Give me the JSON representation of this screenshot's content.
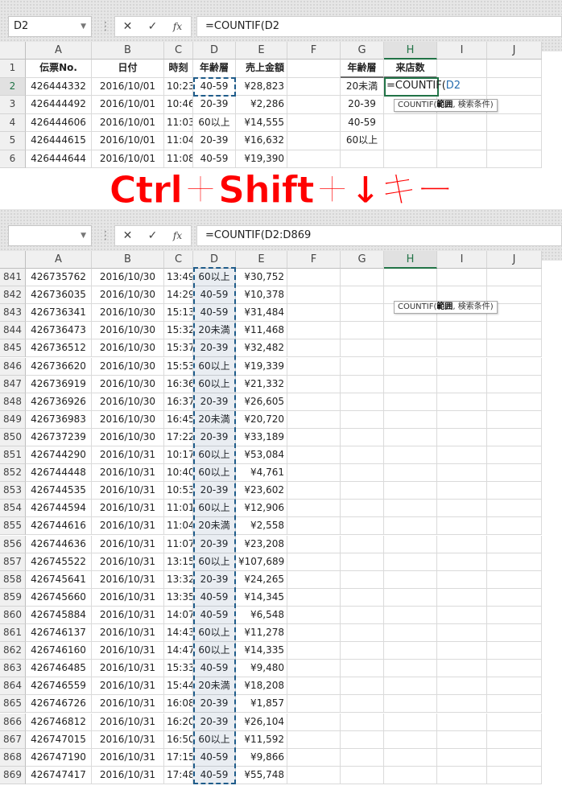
{
  "top": {
    "name_box": "D2",
    "formula": "=COUNTIF(D2",
    "columns": [
      "A",
      "B",
      "C",
      "D",
      "E",
      "F",
      "G",
      "H",
      "I",
      "J"
    ],
    "rows": [
      {
        "n": "1",
        "a": "伝票No.",
        "b": "日付",
        "c": "時刻",
        "d": "年齢層",
        "e": "売上金額",
        "g": "年齢層",
        "h": "来店数"
      },
      {
        "n": "2",
        "a": "426444332",
        "b": "2016/10/01",
        "c": "10:23",
        "d": "40-59",
        "e": "¥28,823",
        "g": "20未満"
      },
      {
        "n": "3",
        "a": "426444492",
        "b": "2016/10/01",
        "c": "10:46",
        "d": "20-39",
        "e": "¥2,286",
        "g": "20-39"
      },
      {
        "n": "4",
        "a": "426444606",
        "b": "2016/10/01",
        "c": "11:03",
        "d": "60以上",
        "e": "¥14,555",
        "g": "40-59"
      },
      {
        "n": "5",
        "a": "426444615",
        "b": "2016/10/01",
        "c": "11:04",
        "d": "20-39",
        "e": "¥16,632",
        "g": "60以上"
      },
      {
        "n": "6",
        "a": "426444644",
        "b": "2016/10/01",
        "c": "11:08",
        "d": "40-59",
        "e": "¥19,390",
        "g": ""
      }
    ],
    "editing_cell": {
      "prefix": "=COUNTIF(",
      "ref": "D2"
    },
    "tooltip": {
      "fn": "COUNTIF(",
      "arg1": "範囲",
      "rest": ", 検索条件)"
    }
  },
  "key_hint": "Ctrl＋Shift＋↓キー",
  "bottom": {
    "name_box": "",
    "formula": "=COUNTIF(D2:D869",
    "columns": [
      "A",
      "B",
      "C",
      "D",
      "E",
      "F",
      "G",
      "H",
      "I",
      "J"
    ],
    "tooltip": {
      "fn": "COUNTIF(",
      "arg1": "範囲",
      "rest": ", 検索条件)"
    },
    "rows": [
      {
        "n": "841",
        "a": "426735762",
        "b": "2016/10/30",
        "c": "13:49",
        "d": "60以上",
        "e": "¥30,752"
      },
      {
        "n": "842",
        "a": "426736035",
        "b": "2016/10/30",
        "c": "14:29",
        "d": "40-59",
        "e": "¥10,378"
      },
      {
        "n": "843",
        "a": "426736341",
        "b": "2016/10/30",
        "c": "15:13",
        "d": "40-59",
        "e": "¥31,484"
      },
      {
        "n": "844",
        "a": "426736473",
        "b": "2016/10/30",
        "c": "15:32",
        "d": "20未満",
        "e": "¥11,468"
      },
      {
        "n": "845",
        "a": "426736512",
        "b": "2016/10/30",
        "c": "15:37",
        "d": "20-39",
        "e": "¥32,482"
      },
      {
        "n": "846",
        "a": "426736620",
        "b": "2016/10/30",
        "c": "15:53",
        "d": "60以上",
        "e": "¥19,339"
      },
      {
        "n": "847",
        "a": "426736919",
        "b": "2016/10/30",
        "c": "16:36",
        "d": "60以上",
        "e": "¥21,332"
      },
      {
        "n": "848",
        "a": "426736926",
        "b": "2016/10/30",
        "c": "16:37",
        "d": "20-39",
        "e": "¥26,605"
      },
      {
        "n": "849",
        "a": "426736983",
        "b": "2016/10/30",
        "c": "16:45",
        "d": "20未満",
        "e": "¥20,720"
      },
      {
        "n": "850",
        "a": "426737239",
        "b": "2016/10/30",
        "c": "17:22",
        "d": "20-39",
        "e": "¥33,189"
      },
      {
        "n": "851",
        "a": "426744290",
        "b": "2016/10/31",
        "c": "10:17",
        "d": "60以上",
        "e": "¥53,084"
      },
      {
        "n": "852",
        "a": "426744448",
        "b": "2016/10/31",
        "c": "10:40",
        "d": "60以上",
        "e": "¥4,761"
      },
      {
        "n": "853",
        "a": "426744535",
        "b": "2016/10/31",
        "c": "10:53",
        "d": "20-39",
        "e": "¥23,602"
      },
      {
        "n": "854",
        "a": "426744594",
        "b": "2016/10/31",
        "c": "11:01",
        "d": "60以上",
        "e": "¥12,906"
      },
      {
        "n": "855",
        "a": "426744616",
        "b": "2016/10/31",
        "c": "11:04",
        "d": "20未満",
        "e": "¥2,558"
      },
      {
        "n": "856",
        "a": "426744636",
        "b": "2016/10/31",
        "c": "11:07",
        "d": "20-39",
        "e": "¥23,208"
      },
      {
        "n": "857",
        "a": "426745522",
        "b": "2016/10/31",
        "c": "13:15",
        "d": "60以上",
        "e": "¥107,689"
      },
      {
        "n": "858",
        "a": "426745641",
        "b": "2016/10/31",
        "c": "13:32",
        "d": "20-39",
        "e": "¥24,265"
      },
      {
        "n": "859",
        "a": "426745660",
        "b": "2016/10/31",
        "c": "13:35",
        "d": "40-59",
        "e": "¥14,345"
      },
      {
        "n": "860",
        "a": "426745884",
        "b": "2016/10/31",
        "c": "14:07",
        "d": "40-59",
        "e": "¥6,548"
      },
      {
        "n": "861",
        "a": "426746137",
        "b": "2016/10/31",
        "c": "14:43",
        "d": "60以上",
        "e": "¥11,278"
      },
      {
        "n": "862",
        "a": "426746160",
        "b": "2016/10/31",
        "c": "14:47",
        "d": "60以上",
        "e": "¥14,335"
      },
      {
        "n": "863",
        "a": "426746485",
        "b": "2016/10/31",
        "c": "15:33",
        "d": "40-59",
        "e": "¥9,480"
      },
      {
        "n": "864",
        "a": "426746559",
        "b": "2016/10/31",
        "c": "15:44",
        "d": "20未満",
        "e": "¥18,208"
      },
      {
        "n": "865",
        "a": "426746726",
        "b": "2016/10/31",
        "c": "16:08",
        "d": "20-39",
        "e": "¥1,857"
      },
      {
        "n": "866",
        "a": "426746812",
        "b": "2016/10/31",
        "c": "16:20",
        "d": "20-39",
        "e": "¥26,104"
      },
      {
        "n": "867",
        "a": "426747015",
        "b": "2016/10/31",
        "c": "16:50",
        "d": "60以上",
        "e": "¥11,592"
      },
      {
        "n": "868",
        "a": "426747190",
        "b": "2016/10/31",
        "c": "17:15",
        "d": "40-59",
        "e": "¥9,866"
      },
      {
        "n": "869",
        "a": "426747417",
        "b": "2016/10/31",
        "c": "17:48",
        "d": "40-59",
        "e": "¥55,748"
      }
    ]
  }
}
